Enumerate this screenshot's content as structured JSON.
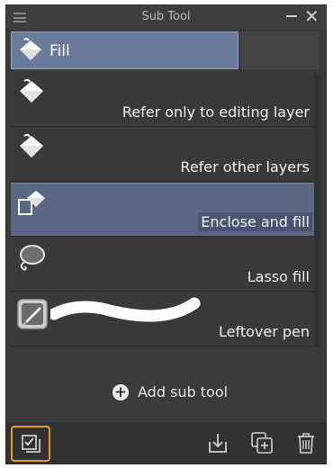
{
  "window": {
    "title": "Sub Tool"
  },
  "group_tab": {
    "label": "Fill",
    "icon": "fill-bucket-icon"
  },
  "items": [
    {
      "label": "Refer only to editing layer",
      "icon": "fill-bucket-icon",
      "selected": false
    },
    {
      "label": "Refer other layers",
      "icon": "fill-bucket-icon",
      "selected": false
    },
    {
      "label": "Enclose and fill",
      "icon": "enclose-fill-icon",
      "selected": true
    },
    {
      "label": "Lasso fill",
      "icon": "lasso-icon",
      "selected": false
    },
    {
      "label": "Leftover pen",
      "icon": "leftover-pen-icon",
      "selected": false
    }
  ],
  "add_sub_tool": {
    "label": "Add sub tool"
  },
  "colors": {
    "panel_bg": "#3b3b3b",
    "selected_bg": "#5b6883",
    "highlight_border": "#e89a2c"
  }
}
